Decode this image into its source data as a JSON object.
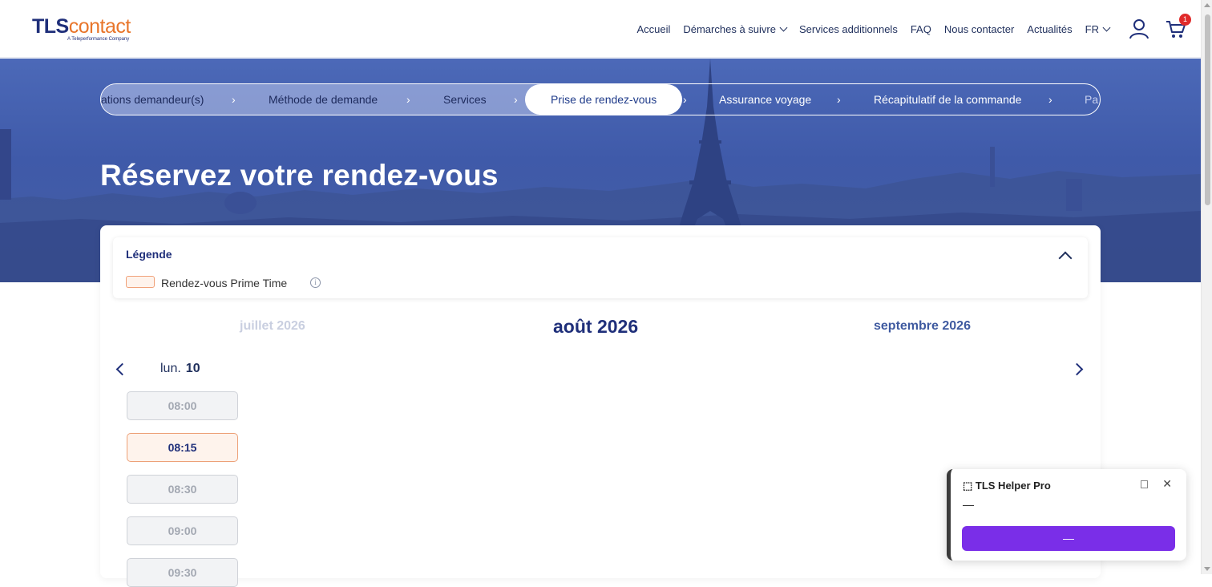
{
  "header": {
    "logo_brand_1": "TLS",
    "logo_brand_2": "contact",
    "logo_tagline": "A Teleperformance Company",
    "nav": {
      "home": "Accueil",
      "steps": "Démarches à suivre",
      "services": "Services additionnels",
      "faq": "FAQ",
      "contact": "Nous contacter",
      "news": "Actualités",
      "lang": "FR"
    },
    "cart_count": "1"
  },
  "stepper": {
    "steps": [
      "ations demandeur(s)",
      "Méthode de demande",
      "Services",
      "Prise de rendez-vous",
      "Assurance voyage",
      "Récapitulatif de la commande",
      "Pa"
    ],
    "separator": "›"
  },
  "page": {
    "title": "Réservez votre rendez-vous"
  },
  "legend": {
    "title": "Légende",
    "item": "Rendez-vous Prime Time",
    "info": "i"
  },
  "calendar": {
    "prev_month": "juillet 2026",
    "current_month": "août 2026",
    "next_month": "septembre 2026",
    "day_name": "lun.",
    "day_number": "10",
    "slots": [
      {
        "time": "08:00",
        "prime": false
      },
      {
        "time": "08:15",
        "prime": true
      },
      {
        "time": "08:30",
        "prime": false
      },
      {
        "time": "09:00",
        "prime": false
      },
      {
        "time": "09:30",
        "prime": false
      }
    ]
  },
  "helper": {
    "title": "⬚ TLS Helper Pro",
    "status": "—",
    "button": "—",
    "close": "✕"
  },
  "colors": {
    "brand_navy": "#1f2f7a",
    "brand_orange": "#e8752a",
    "hero_blue": "#4c69b8",
    "prime_border": "#eda178",
    "helper_button": "#7a2ee8",
    "badge_red": "#e02a2a"
  },
  "icons": {
    "user": "user-icon",
    "cart": "cart-icon",
    "legend_toggle": "chevron-up-icon",
    "prev": "chevron-left-icon",
    "next": "chevron-right-icon"
  }
}
